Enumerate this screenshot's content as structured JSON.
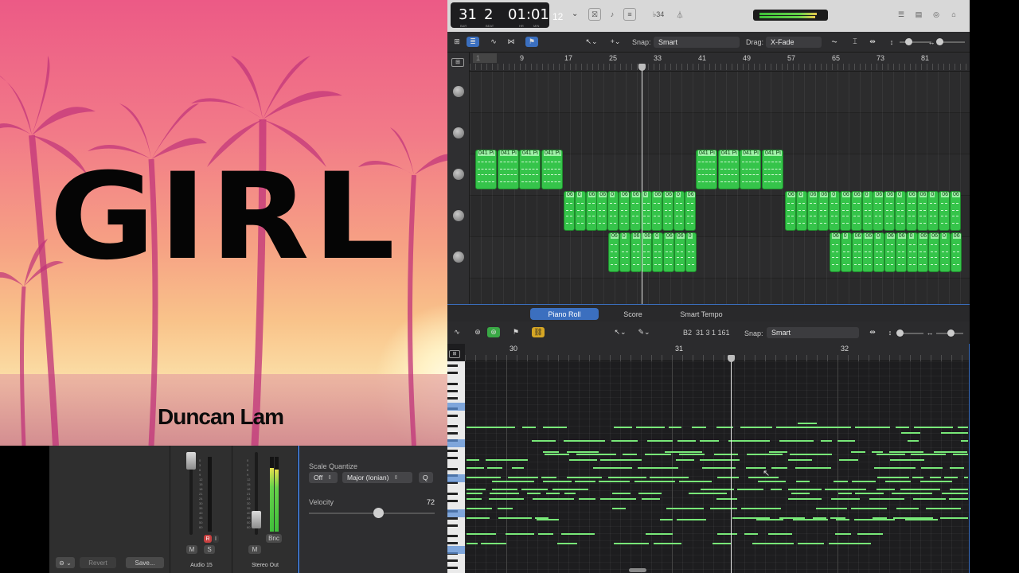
{
  "album": {
    "title": "GIRL",
    "artist": "Duncan Lam"
  },
  "control_bar": {
    "bar": "31",
    "beat": "2",
    "time": "01:01",
    "time_sub": "12",
    "bar_label": "BAR",
    "beat_label": "BEAT",
    "hr_label": "HR",
    "min_label": "MIN",
    "sec_label": "SEC",
    "key_sig": "♭34"
  },
  "tracks_toolbar": {
    "snap_label": "Snap:",
    "snap_value": "Smart",
    "drag_label": "Drag:",
    "drag_value": "X-Fade"
  },
  "tracks_ruler": [
    "1",
    "9",
    "17",
    "25",
    "33",
    "41",
    "49",
    "57",
    "65",
    "73",
    "81"
  ],
  "regions": {
    "lane2_label": "041 Pi",
    "lane3_label": "06",
    "lane3_alt": "0"
  },
  "piano_roll": {
    "tabs": [
      "Piano Roll",
      "Score",
      "Smart Tempo"
    ],
    "active_tab": "Piano Roll",
    "position": "B2  31 3 1 161",
    "snap_label": "Snap:",
    "snap_value": "Smart",
    "ruler": [
      "30",
      "31",
      "32"
    ]
  },
  "inspector": {
    "scale_quantize_label": "Scale Quantize",
    "scale_off": "Off",
    "scale_mode": "Major (Ionian)",
    "q_button": "Q",
    "velocity_label": "Velocity",
    "velocity_value": "72",
    "velocity_fraction": 0.55
  },
  "mixer": {
    "revert": "Revert",
    "save": "Save...",
    "m": "M",
    "s": "S",
    "r": "R",
    "i": "I",
    "bnc": "Bnc",
    "channel1": "Audio 15",
    "channel2": "Stereo Out"
  },
  "colors": {
    "region_green": "#35c44a",
    "note_green": "#78e878",
    "accent_blue": "#3b6fbf"
  }
}
